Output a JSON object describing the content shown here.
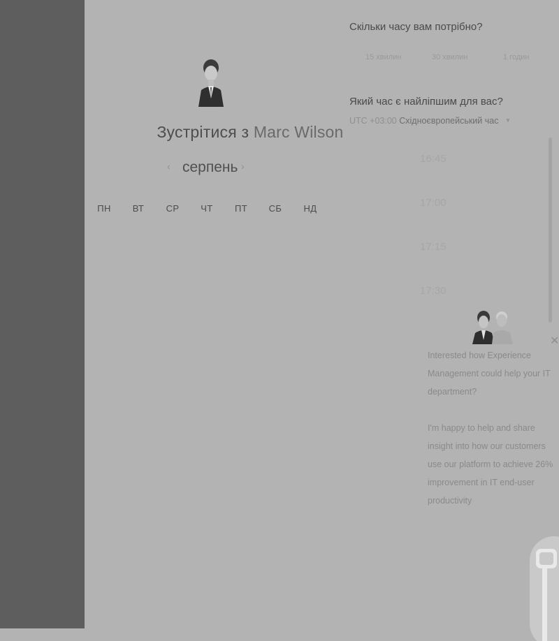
{
  "booking": {
    "title_prefix": "Зустрітися з",
    "host_name": "Marc Wilson",
    "month": "серпень",
    "prev_arrow": "‹",
    "next_arrow": "›",
    "weekdays": [
      "ПН",
      "ВТ",
      "СР",
      "ЧТ",
      "ПТ",
      "СБ",
      "НД"
    ]
  },
  "duration": {
    "question": "Скільки часу вам потрібно?",
    "options": [
      "15 хвилин",
      "30 хвилин",
      "1 годин"
    ]
  },
  "time": {
    "question": "Який час є найліпшим для вас?",
    "timezone_offset": "UTC +03:00",
    "timezone_name": "Східноєвропейський час",
    "timezone_caret": "▼",
    "slots": [
      "16:45",
      "17:00",
      "17:15",
      "17:30"
    ]
  },
  "chat": {
    "close": "✕",
    "message_1": "Interested how Experience Management could help your IT department?",
    "message_2": "I'm happy to help and share insight into how our customers use our platform to achieve 26% improvement in IT end-user productivity"
  },
  "colors": {
    "left_panel": "#5e5e5e",
    "background": "#b3b3b3",
    "text_dark": "#4a4a4a",
    "text_muted": "#9a9a9a"
  }
}
